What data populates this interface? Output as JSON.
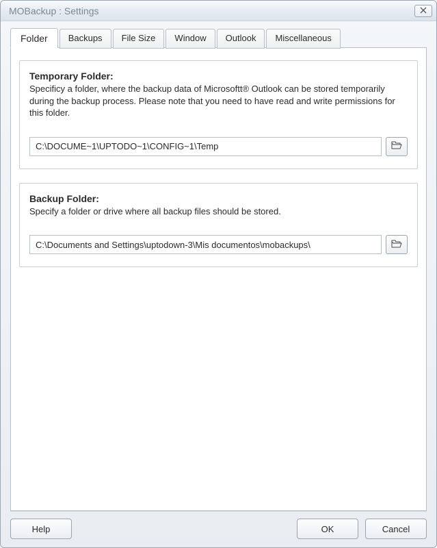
{
  "window": {
    "title": "MOBackup : Settings"
  },
  "tabs": [
    {
      "label": "Folder",
      "active": true
    },
    {
      "label": "Backups",
      "active": false
    },
    {
      "label": "File Size",
      "active": false
    },
    {
      "label": "Window",
      "active": false
    },
    {
      "label": "Outlook",
      "active": false
    },
    {
      "label": "Miscellaneous",
      "active": false
    }
  ],
  "groups": {
    "temp": {
      "title": "Temporary Folder:",
      "desc": "Specificy a folder, where the backup data of Microsoftt® Outlook can be stored temporarily during the backup process. Please note that you need to have read and write permissions for this folder.",
      "path": "C:\\DOCUME~1\\UPTODO~1\\CONFIG~1\\Temp"
    },
    "backup": {
      "title": "Backup Folder:",
      "desc": "Specify a folder or drive where all backup files should be stored.",
      "path": "C:\\Documents and Settings\\uptodown-3\\Mis documentos\\mobackups\\"
    }
  },
  "buttons": {
    "help": "Help",
    "ok": "OK",
    "cancel": "Cancel"
  }
}
